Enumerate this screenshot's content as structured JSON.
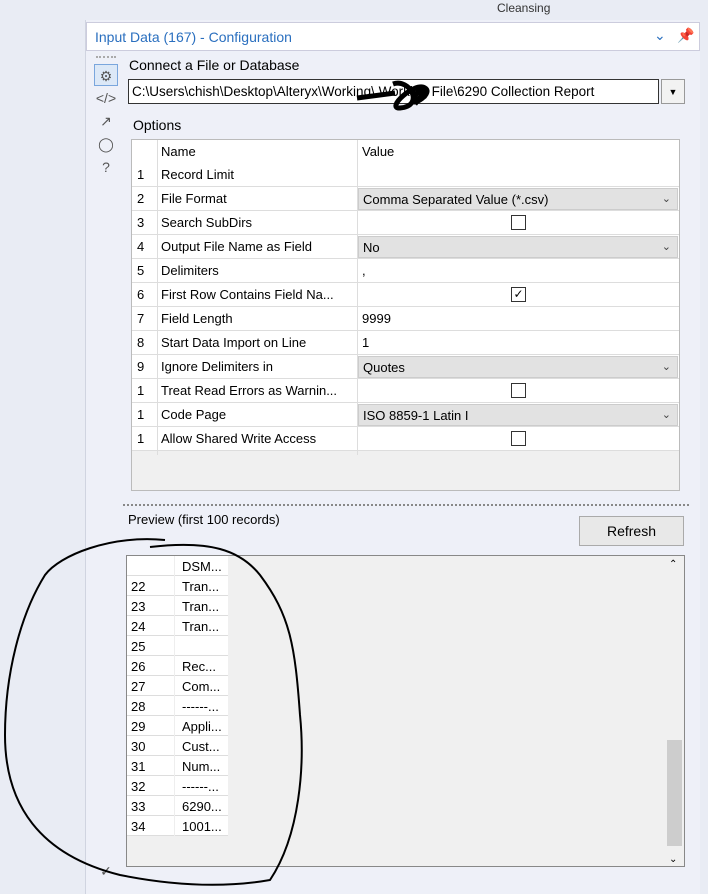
{
  "ribbon": {
    "tab": "Cleansing"
  },
  "header": {
    "title": "Input Data (167) - Configuration"
  },
  "config": {
    "connect_label": "Connect a File or Database",
    "path": "C:\\Users\\chish\\Desktop\\Alteryx\\Working\\      Working File\\6290 Collection Report"
  },
  "options": {
    "label": "Options",
    "col_name": "Name",
    "col_value": "Value",
    "rows": [
      {
        "n": "1",
        "name": "Record Limit",
        "type": "text",
        "value": ""
      },
      {
        "n": "2",
        "name": "File Format",
        "type": "dropdown",
        "value": "Comma Separated Value (*.csv)"
      },
      {
        "n": "3",
        "name": "Search SubDirs",
        "type": "check",
        "checked": false
      },
      {
        "n": "4",
        "name": "Output File Name as Field",
        "type": "dropdown",
        "value": "No"
      },
      {
        "n": "5",
        "name": "Delimiters",
        "type": "text",
        "value": ","
      },
      {
        "n": "6",
        "name": "First Row Contains Field Na...",
        "type": "check",
        "checked": true
      },
      {
        "n": "7",
        "name": "Field Length",
        "type": "text",
        "value": "9999"
      },
      {
        "n": "8",
        "name": "Start Data Import on Line",
        "type": "text",
        "value": "1"
      },
      {
        "n": "9",
        "name": "Ignore Delimiters in",
        "type": "dropdown",
        "value": "Quotes"
      },
      {
        "n": "1",
        "name": "Treat Read Errors as Warnin...",
        "type": "check",
        "checked": false
      },
      {
        "n": "1",
        "name": "Code Page",
        "type": "dropdown",
        "value": "ISO 8859-1 Latin I"
      },
      {
        "n": "1",
        "name": "Allow Shared Write Access",
        "type": "check",
        "checked": false
      }
    ]
  },
  "preview": {
    "label": "Preview (first 100 records)",
    "refresh": "Refresh",
    "column": "DSM...",
    "rows": [
      [
        "22",
        "Tran..."
      ],
      [
        "23",
        "Tran..."
      ],
      [
        "24",
        "Tran..."
      ],
      [
        "25",
        ""
      ],
      [
        "26",
        "Rec..."
      ],
      [
        "27",
        "Com..."
      ],
      [
        "28",
        "------..."
      ],
      [
        "29",
        "Appli..."
      ],
      [
        "30",
        "Cust..."
      ],
      [
        "31",
        "Num..."
      ],
      [
        "32",
        "------..."
      ],
      [
        "33",
        "6290..."
      ],
      [
        "34",
        "1001..."
      ]
    ]
  }
}
